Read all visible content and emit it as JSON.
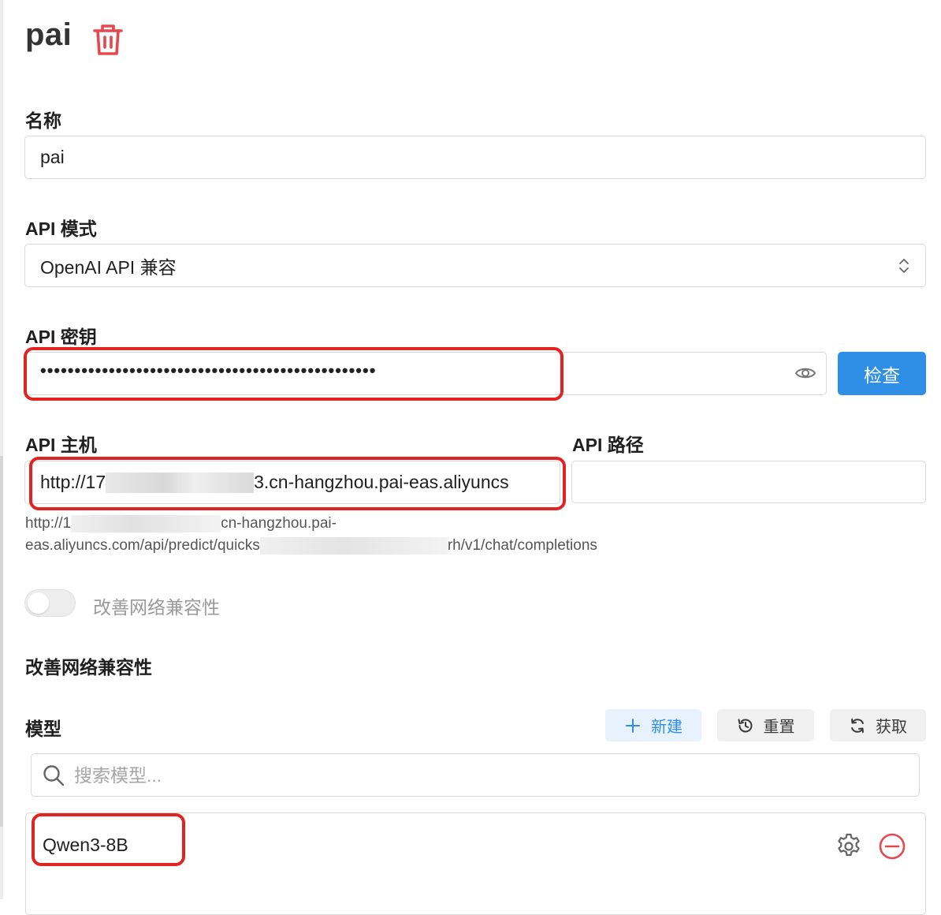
{
  "provider": {
    "title": "pai"
  },
  "form": {
    "name_label": "名称",
    "name_value": "pai",
    "api_mode_label": "API 模式",
    "api_mode_value": "OpenAI API 兼容",
    "api_key_label": "API 密钥",
    "api_key_mask": "•••••••••••••••••••••••••••••••••••••••••••••••••",
    "check_button": "检查",
    "api_host_label": "API 主机",
    "api_host_prefix": "http://17",
    "api_host_suffix": "3.cn-hangzhou.pai-eas.aliyuncs",
    "api_path_label": "API 路径",
    "api_path_value": "",
    "hint_line1_prefix": "http://1",
    "hint_line1_suffix": "cn-hangzhou.pai-",
    "hint_line2_prefix": "eas.aliyuncs.com/api/predict/quicks",
    "hint_line2_suffix": "rh/v1/chat/completions",
    "toggle_label": "改善网络兼容性",
    "toggle_on": false,
    "section_heading": "改善网络兼容性"
  },
  "models": {
    "label": "模型",
    "new_button": "新建",
    "reset_button": "重置",
    "fetch_button": "获取",
    "search_placeholder": "搜索模型...",
    "items": [
      {
        "name": "Qwen3-8B"
      }
    ]
  },
  "colors": {
    "primary": "#2f8ee6",
    "danger": "#e5484d",
    "highlight_box": "#e02424"
  }
}
